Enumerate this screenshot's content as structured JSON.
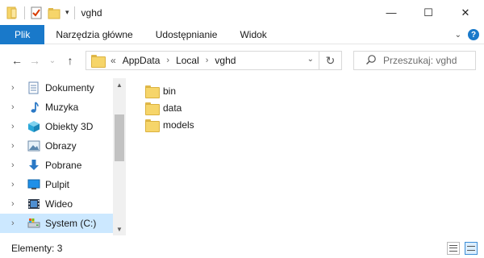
{
  "window": {
    "title": "vghd",
    "buttons": {
      "minimize": "—",
      "maximize": "☐",
      "close": "✕"
    }
  },
  "quick_access": {
    "dropdown": "▾"
  },
  "ribbon": {
    "tabs": [
      "Plik",
      "Narzędzia główne",
      "Udostępnianie",
      "Widok"
    ],
    "expand_glyph": "⌄",
    "help_glyph": "?"
  },
  "nav": {
    "back": "←",
    "forward": "→",
    "recent": "⌄",
    "up": "↑"
  },
  "address": {
    "overflow": "«",
    "path": [
      "AppData",
      "Local",
      "vghd"
    ],
    "separator": "›",
    "dropdown": "⌄",
    "refresh": "↻"
  },
  "search": {
    "placeholder": "Przeszukaj: vghd"
  },
  "nav_pane": {
    "items": [
      {
        "label": "Dokumenty",
        "icon": "documents-icon"
      },
      {
        "label": "Muzyka",
        "icon": "music-icon"
      },
      {
        "label": "Obiekty 3D",
        "icon": "objects3d-icon"
      },
      {
        "label": "Obrazy",
        "icon": "pictures-icon"
      },
      {
        "label": "Pobrane",
        "icon": "downloads-icon"
      },
      {
        "label": "Pulpit",
        "icon": "desktop-icon"
      },
      {
        "label": "Wideo",
        "icon": "videos-icon"
      },
      {
        "label": "System (C:)",
        "icon": "drive-icon",
        "selected": true
      }
    ],
    "chevron": "›"
  },
  "content": {
    "items": [
      {
        "name": "bin",
        "type": "folder"
      },
      {
        "name": "data",
        "type": "folder"
      },
      {
        "name": "models",
        "type": "folder"
      }
    ]
  },
  "status": {
    "text": "Elementy: 3"
  },
  "colors": {
    "accent": "#1979ca",
    "selection": "#cce8ff",
    "folder": "#f6d56a"
  }
}
